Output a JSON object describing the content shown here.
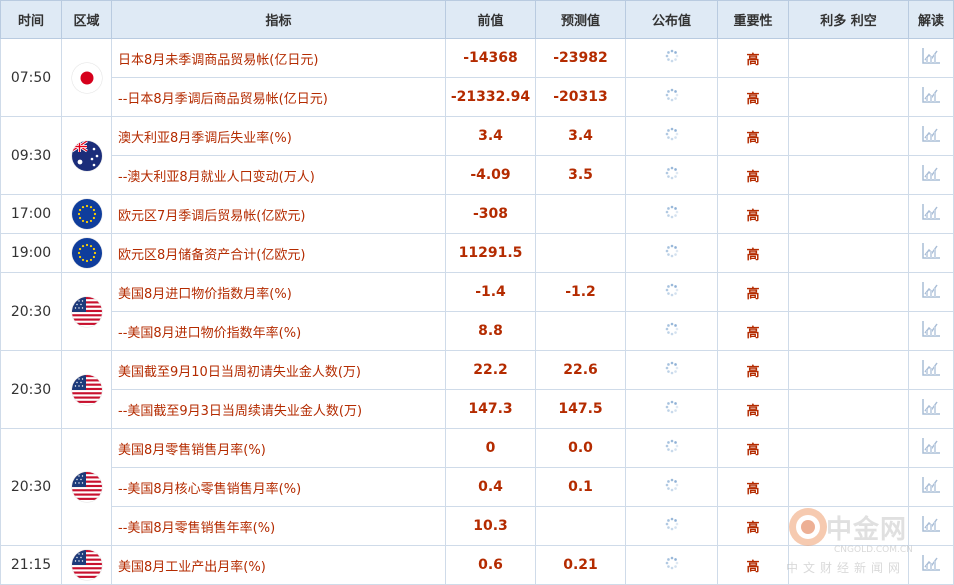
{
  "header": {
    "time": "时间",
    "region": "区域",
    "indicator": "指标",
    "previous": "前值",
    "forecast": "预测值",
    "actual": "公布值",
    "importance": "重要性",
    "impact": "利多 利空",
    "analysis": "解读"
  },
  "rows": [
    {
      "indicator": "日本8月未季调商品贸易帐(亿日元)",
      "previous": "-14368",
      "forecast": "-23982",
      "importance": "高"
    },
    {
      "indicator": "--日本8月季调后商品贸易帐(亿日元)",
      "previous": "-21332.94",
      "forecast": "-20313",
      "importance": "高"
    },
    {
      "indicator": "澳大利亚8月季调后失业率(%)",
      "previous": "3.4",
      "forecast": "3.4",
      "importance": "高"
    },
    {
      "indicator": "--澳大利亚8月就业人口变动(万人)",
      "previous": "-4.09",
      "forecast": "3.5",
      "importance": "高"
    },
    {
      "indicator": "欧元区7月季调后贸易帐(亿欧元)",
      "previous": "-308",
      "forecast": "",
      "importance": "高"
    },
    {
      "indicator": "欧元区8月储备资产合计(亿欧元)",
      "previous": "11291.5",
      "forecast": "",
      "importance": "高"
    },
    {
      "indicator": "美国8月进口物价指数月率(%)",
      "previous": "-1.4",
      "forecast": "-1.2",
      "importance": "高"
    },
    {
      "indicator": "--美国8月进口物价指数年率(%)",
      "previous": "8.8",
      "forecast": "",
      "importance": "高"
    },
    {
      "indicator": "美国截至9月10日当周初请失业金人数(万)",
      "previous": "22.2",
      "forecast": "22.6",
      "importance": "高"
    },
    {
      "indicator": "--美国截至9月3日当周续请失业金人数(万)",
      "previous": "147.3",
      "forecast": "147.5",
      "importance": "高"
    },
    {
      "indicator": "美国8月零售销售月率(%)",
      "previous": "0",
      "forecast": "0.0",
      "importance": "高"
    },
    {
      "indicator": "--美国8月核心零售销售月率(%)",
      "previous": "0.4",
      "forecast": "0.1",
      "importance": "高"
    },
    {
      "indicator": "--美国8月零售销售年率(%)",
      "previous": "10.3",
      "forecast": "",
      "importance": "高"
    },
    {
      "indicator": "美国8月工业产出月率(%)",
      "previous": "0.6",
      "forecast": "0.21",
      "importance": "高"
    }
  ],
  "groups": [
    {
      "time": "07:50",
      "flag": "japan-flag-icon"
    },
    {
      "time": "09:30",
      "flag": "australia-flag-icon"
    },
    {
      "time": "17:00",
      "flag": "eu-flag-icon"
    },
    {
      "time": "19:00",
      "flag": "eu-flag-icon"
    },
    {
      "time": "20:30",
      "flag": "us-flag-icon"
    },
    {
      "time": "20:30",
      "flag": "us-flag-icon"
    },
    {
      "time": "20:30",
      "flag": "us-flag-icon"
    },
    {
      "time": "21:15",
      "flag": "us-flag-icon"
    }
  ],
  "watermark": {
    "brand": "中金网",
    "url": "CNGOLD.COM.CN",
    "sub": "中文财经新闻网"
  },
  "colors": {
    "header_bg": "#dfeaf5",
    "accent_red": "#b42b00",
    "border": "#cfdbe9"
  }
}
